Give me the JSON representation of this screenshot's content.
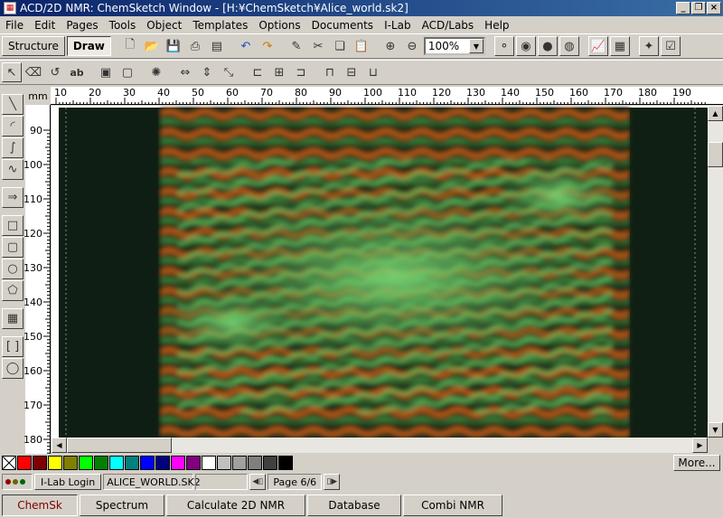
{
  "window": {
    "title": "ACD/2D NMR: ChemSketch Window - [H:¥ChemSketch¥Alice_world.sk2]"
  },
  "menu": [
    "File",
    "Edit",
    "Pages",
    "Tools",
    "Object",
    "Templates",
    "Options",
    "Documents",
    "I-Lab",
    "ACD/Labs",
    "Help"
  ],
  "mode": {
    "structure": "Structure",
    "draw": "Draw"
  },
  "zoom": {
    "value": "100%"
  },
  "ruler": {
    "unit": "mm",
    "h_ticks": [
      "10",
      "20",
      "30",
      "40",
      "50",
      "60",
      "70",
      "80",
      "90",
      "100",
      "110",
      "120",
      "130",
      "140",
      "150",
      "160",
      "170",
      "180",
      "190"
    ],
    "v_ticks": [
      "90",
      "100",
      "110",
      "120",
      "130",
      "140",
      "150",
      "160",
      "170",
      "180"
    ]
  },
  "palette": {
    "colors": [
      "#ff0000",
      "#800000",
      "#ffff00",
      "#808000",
      "#00ff00",
      "#008000",
      "#00ffff",
      "#008080",
      "#0000ff",
      "#000080",
      "#ff00ff",
      "#800080",
      "#ffffff",
      "#c0c0c0",
      "#a0a0a0",
      "#808080",
      "#404040",
      "#000000"
    ],
    "more_label": "More..."
  },
  "status": {
    "login": "I-Lab Login",
    "filename": "ALICE_WORLD.SK2",
    "page": "Page 6/6"
  },
  "apps": [
    "ChemSk",
    "Spectrum",
    "Calculate 2D NMR",
    "Database",
    "Combi NMR"
  ]
}
